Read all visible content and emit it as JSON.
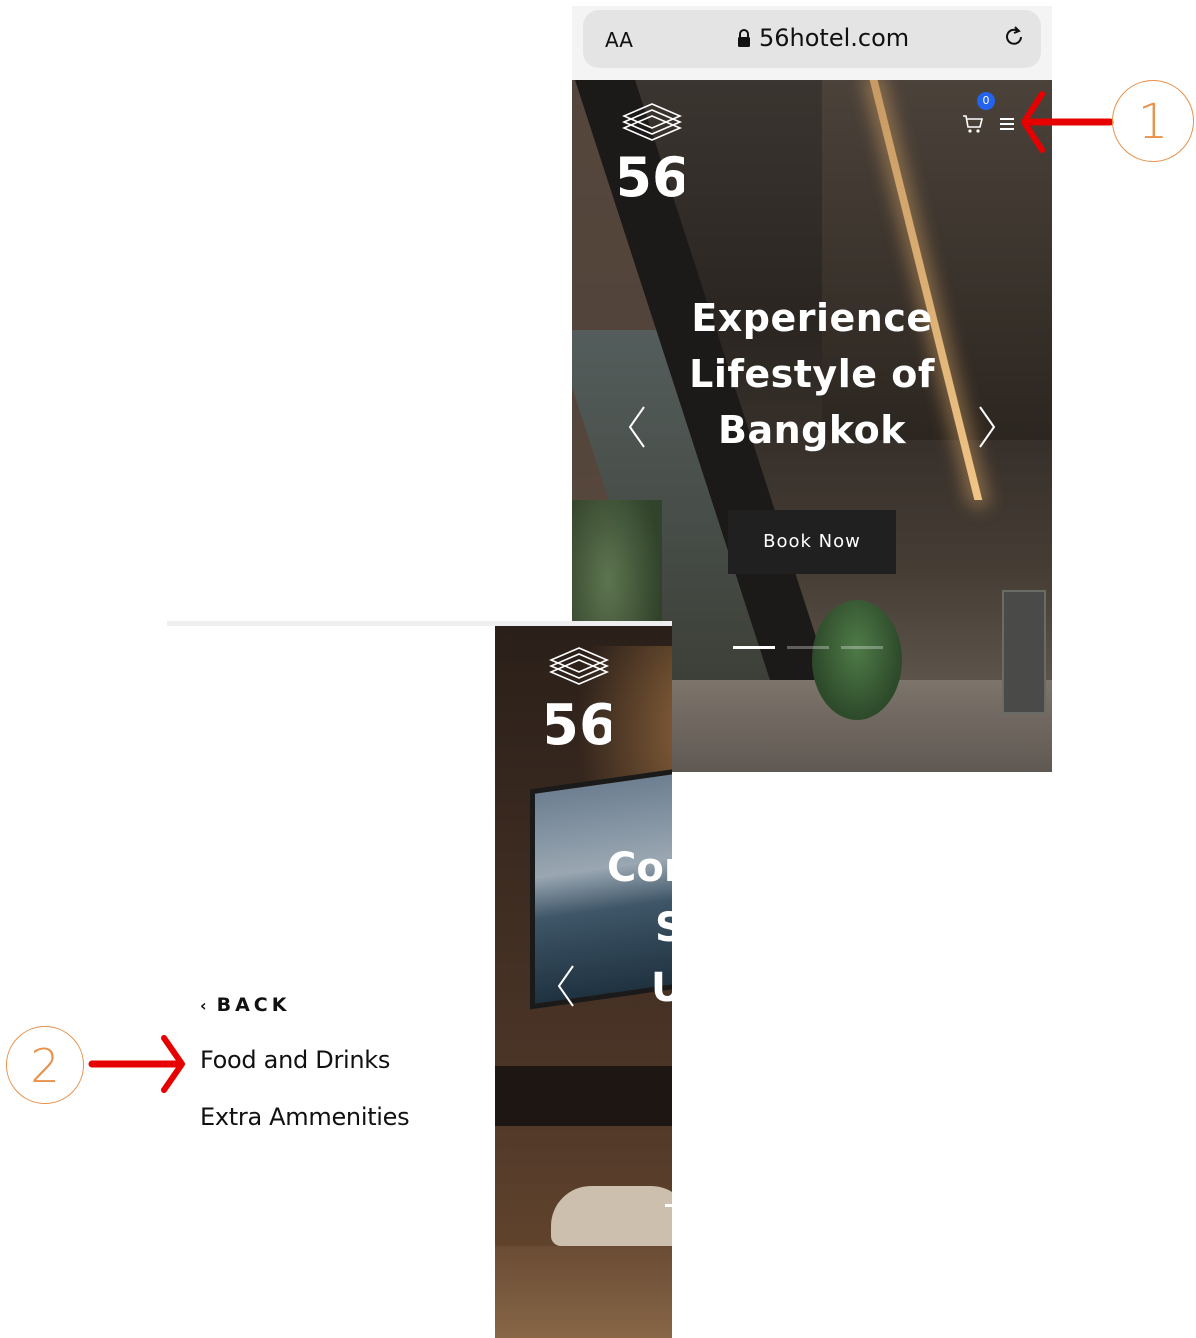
{
  "browser": {
    "text_size_label": "AA",
    "url": "56hotel.com",
    "icons": [
      "lock-icon",
      "reload-icon"
    ]
  },
  "screen1": {
    "logo_text": "56",
    "cart_count": "0",
    "hero_title_lines": [
      "Experience",
      "Lifestyle of",
      "Bangkok"
    ],
    "book_button": "Book Now",
    "slide_indicator": {
      "active": 1,
      "total": 3
    }
  },
  "screen2": {
    "logo_text": "56",
    "hero_title_lines": [
      "Cor",
      "S",
      "U"
    ],
    "menu": {
      "back_label": "BACK",
      "items": [
        "Food and Drinks",
        "Extra Ammenities"
      ]
    }
  },
  "annotations": {
    "step1": "1",
    "step2": "2",
    "arrow_color": "#e60000",
    "circle_color": "#e8914a"
  }
}
